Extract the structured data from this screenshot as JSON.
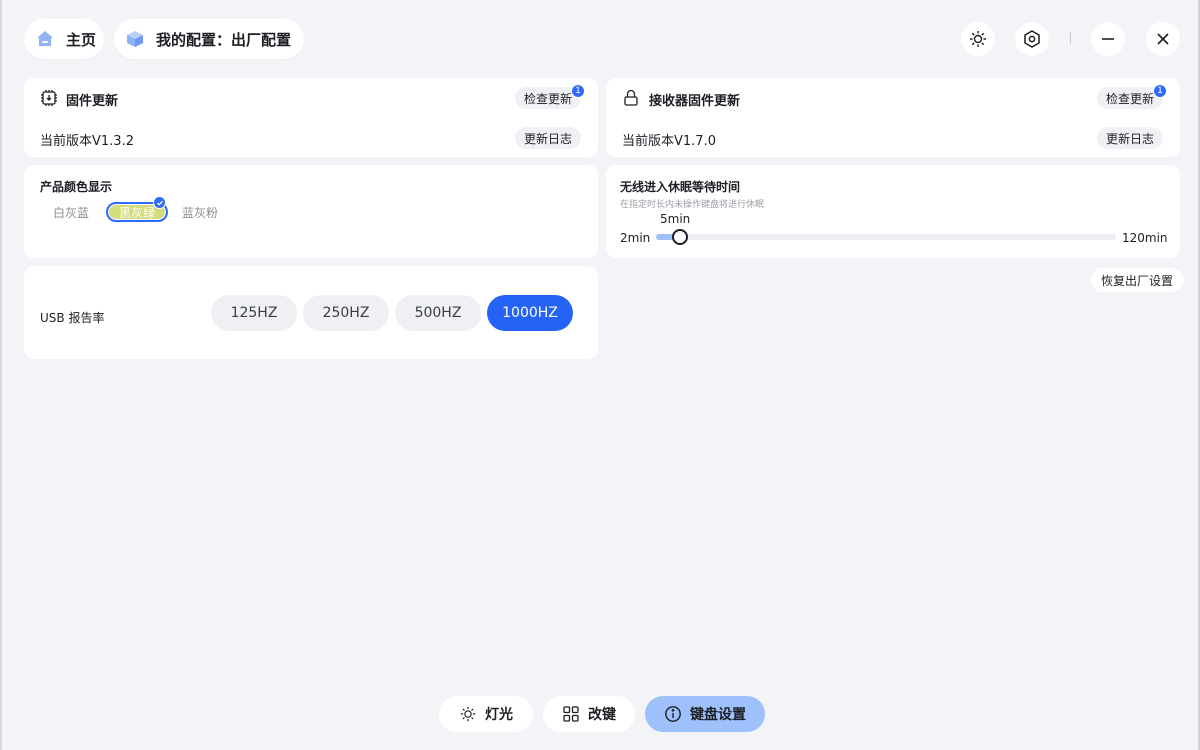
{
  "header": {
    "home_label": "主页",
    "config_label": "我的配置：出厂配置"
  },
  "icons": {
    "home": "home-icon",
    "config": "cube-icon",
    "brightness": "sun-icon",
    "settings": "hexagon-gear-icon",
    "minimize": "minimize-icon",
    "close": "close-icon"
  },
  "firmware": {
    "title": "固件更新",
    "check_label": "检查更新",
    "badge": "1",
    "version": "当前版本V1.3.2",
    "changelog_label": "更新日志"
  },
  "receiver": {
    "title": "接收器固件更新",
    "check_label": "检查更新",
    "badge": "1",
    "version": "当前版本V1.7.0",
    "changelog_label": "更新日志"
  },
  "product_color": {
    "title": "产品颜色显示",
    "options": [
      "白灰蓝",
      "黑灰绿",
      "蓝灰粉"
    ],
    "selected": "黑灰绿",
    "selected_color": "#d4dc7e"
  },
  "sleep": {
    "title": "无线进入休眠等待时间",
    "subtitle": "在指定时长内未操作键盘将进行休眠",
    "current_label": "5min",
    "min_label": "2min",
    "max_label": "120min",
    "min": 2,
    "max": 120,
    "value": 5
  },
  "restore_label": "恢复出厂设置",
  "usb": {
    "title": "USB 报告率",
    "options": [
      "125HZ",
      "250HZ",
      "500HZ",
      "1000HZ"
    ],
    "selected": "1000HZ"
  },
  "bottom_tabs": [
    {
      "label": "灯光",
      "icon": "sun-icon"
    },
    {
      "label": "改键",
      "icon": "grid-icon"
    },
    {
      "label": "键盘设置",
      "icon": "info-icon",
      "active": true
    }
  ],
  "colors": {
    "accent": "#2463f6",
    "active_tab": "#9ec0fb",
    "badge": "#2f6bff"
  }
}
